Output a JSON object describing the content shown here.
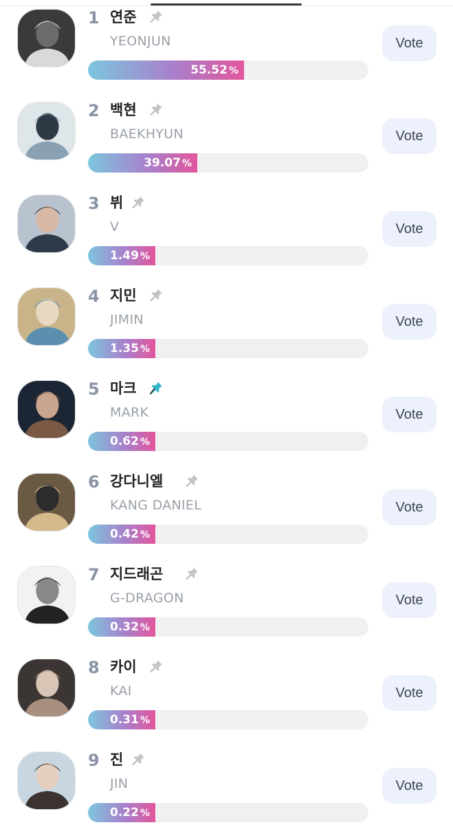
{
  "candidates": [
    {
      "rank": "1",
      "korean": "연준",
      "english": "YEONJUN",
      "percent": 55.52,
      "percent_label": "55.52",
      "pinned": false,
      "vote_label": "Vote"
    },
    {
      "rank": "2",
      "korean": "백현",
      "english": "BAEKHYUN",
      "percent": 39.07,
      "percent_label": "39.07",
      "pinned": false,
      "vote_label": "Vote"
    },
    {
      "rank": "3",
      "korean": "뷔",
      "english": "V",
      "percent": 1.49,
      "percent_label": "1.49",
      "pinned": false,
      "vote_label": "Vote"
    },
    {
      "rank": "4",
      "korean": "지민",
      "english": "JIMIN",
      "percent": 1.35,
      "percent_label": "1.35",
      "pinned": false,
      "vote_label": "Vote"
    },
    {
      "rank": "5",
      "korean": "마크",
      "english": "MARK",
      "percent": 0.62,
      "percent_label": "0.62",
      "pinned": true,
      "vote_label": "Vote"
    },
    {
      "rank": "6",
      "korean": "강다니엘",
      "english": "KANG DANIEL",
      "percent": 0.42,
      "percent_label": "0.42",
      "pinned": false,
      "vote_label": "Vote"
    },
    {
      "rank": "7",
      "korean": "지드래곤",
      "english": "G-DRAGON",
      "percent": 0.32,
      "percent_label": "0.32",
      "pinned": false,
      "vote_label": "Vote"
    },
    {
      "rank": "8",
      "korean": "카이",
      "english": "KAI",
      "percent": 0.31,
      "percent_label": "0.31",
      "pinned": false,
      "vote_label": "Vote"
    },
    {
      "rank": "9",
      "korean": "진",
      "english": "JIN",
      "percent": 0.22,
      "percent_label": "0.22",
      "pinned": false,
      "vote_label": "Vote"
    }
  ],
  "percent_sign": "%",
  "colors": {
    "bar_start": "#7cc6de",
    "bar_end": "#e2569c",
    "pin_inactive": "#c4c4c8",
    "pin_active": "#2fb6c9",
    "vote_bg": "#edf1fb",
    "rank": "#8a94a6"
  }
}
